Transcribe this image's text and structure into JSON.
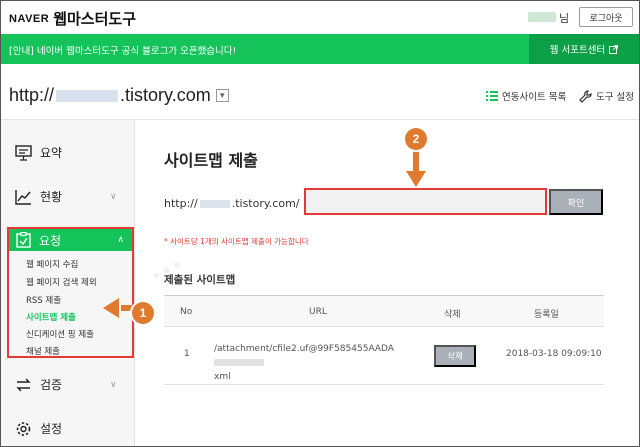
{
  "app": {
    "naver_label": "NAVER",
    "title": "웹마스터도구",
    "user_suffix": "님",
    "logout_label": "로그아웃"
  },
  "notice": {
    "text": "[안내] 네이버 웹마스터도구 공식 블로그가 오픈했습니다!",
    "webmaster_center_label": "웹 서포트센터"
  },
  "site": {
    "url_prefix": "http://",
    "url_suffix": ".tistory.com",
    "site_list_label": "연동사이트 목록",
    "tool_settings_label": "도구 설정"
  },
  "sidebar": {
    "items": [
      {
        "label": "요약",
        "icon": "monitor-icon"
      },
      {
        "label": "현황",
        "icon": "line-chart-icon"
      },
      {
        "label": "요청",
        "icon": "clipboard-check-icon"
      },
      {
        "label": "검증",
        "icon": "swap-arrows-icon"
      },
      {
        "label": "설정",
        "icon": "gear-icon"
      }
    ],
    "sub_items": [
      "웹 페이지 수집",
      "웹 페이지 검색 제외",
      "RSS 제출",
      "사이트맵 제출",
      "신디케이션 핑 제출",
      "채널 제출"
    ],
    "active_sub": "사이트맵 제출"
  },
  "main": {
    "page_title": "사이트맵 제출",
    "url_prefix": "http://",
    "url_suffix": ".tistory.com/",
    "input_value": "",
    "confirm_label": "확인",
    "note": "* 사이트당 1개의 사이트맵 제출이 가능합니다",
    "submitted_title": "제출된 사이트맵",
    "table": {
      "headers": [
        "No",
        "URL",
        "삭제",
        "등록일"
      ],
      "rows": [
        {
          "no": "1",
          "url_line1": "/attachment/cfile2.uf@99F585455AADA",
          "url_line2": "xml",
          "delete_label": "삭제",
          "date": "2018-03-18 09:09:10"
        }
      ]
    }
  },
  "annotations": {
    "badge_1": "1",
    "badge_2": "2",
    "arrow_color": "#e07a2e",
    "highlight_color": "#e53935"
  },
  "colors": {
    "brand_green": "#14c35a",
    "brand_green_dark": "#0b9f46"
  }
}
